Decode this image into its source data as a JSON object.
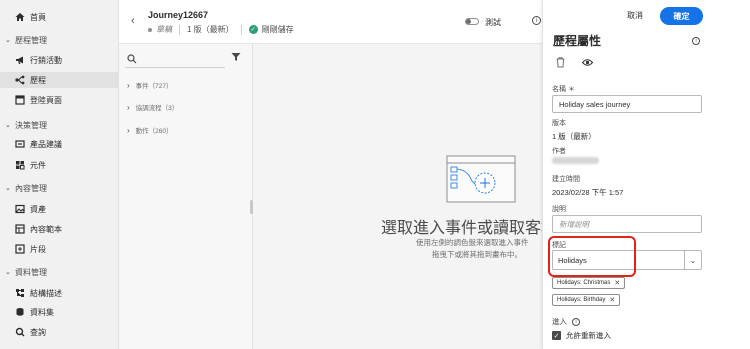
{
  "nav": {
    "home": "首頁",
    "section_journey": "歷程管理",
    "campaigns": "行銷活動",
    "journeys": "歷程",
    "landing_pages": "登陸頁面",
    "section_decision": "決策管理",
    "offers": "產品建議",
    "components": "元件",
    "section_content": "內容管理",
    "assets": "資產",
    "content_templates": "內容範本",
    "fragments": "片段",
    "section_data": "資料管理",
    "schemas": "結構描述",
    "datasets": "資料集",
    "queries": "查詢"
  },
  "header": {
    "title": "Journey12667",
    "status": "草稿",
    "version": "1 版（最新）",
    "save_status": "剛剛儲存",
    "test_label": "測試"
  },
  "palette": {
    "events": "事件（727）",
    "orchestration": "協調流程（3）",
    "actions": "動作（260）"
  },
  "canvas": {
    "empty_title": "選取進入事件或讀取客群",
    "empty_sub1": "使用左側的調色盤來選取進入事件",
    "empty_sub2": "拖曳下或將其拖到畫布中。"
  },
  "panel": {
    "cancel": "取消",
    "confirm": "確定",
    "title": "歷程屬性",
    "name_label": "名稱 ＊",
    "name_value": "Holiday sales journey",
    "version_label": "版本",
    "version_value": "1 版（最新）",
    "author_label": "作者",
    "created_label": "建立時間",
    "created_value": "2023/02/28 下午 1:57",
    "description_label": "說明",
    "description_placeholder": "新增說明",
    "tags_label": "標記",
    "tags_input": "Holidays",
    "tags": [
      "Holidays: Christmas",
      "Holidays: Birthday"
    ],
    "entry_label": "進入",
    "allow_reentry": "允許重新進入"
  },
  "colors": {
    "accent": "#1473e6",
    "highlight": "#e2231a",
    "success": "#2d9d78"
  }
}
